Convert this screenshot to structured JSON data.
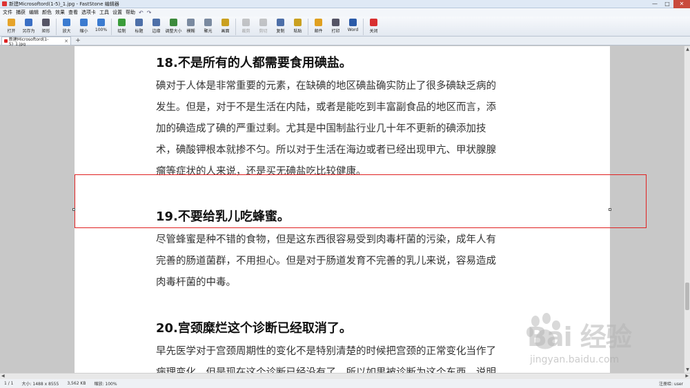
{
  "window": {
    "title": "新建Microsoftord(1-5)_1.jpg - FastStone 编辑器",
    "controls": [
      "—",
      "□",
      "✕"
    ]
  },
  "menu": {
    "items": [
      "文件",
      "捕获",
      "编辑",
      "颜色",
      "效果",
      "查看",
      "选项卡",
      "工具",
      "设置",
      "帮助"
    ]
  },
  "toolbar": {
    "tools": [
      {
        "label": "打开",
        "icon": "open-folder-icon",
        "color": "#e6a42b"
      },
      {
        "label": "另存为",
        "icon": "save-icon",
        "color": "#3a6fc4"
      },
      {
        "label": "矩形",
        "icon": "rect-select-icon",
        "color": "#556"
      },
      {
        "label": "放大",
        "icon": "zoom-in-icon",
        "color": "#3b7bd0"
      },
      {
        "label": "缩小",
        "icon": "zoom-out-icon",
        "color": "#3b7bd0"
      },
      {
        "label": "100%",
        "icon": "zoom-100-icon",
        "color": "#3b7bd0"
      },
      {
        "label": "绘制",
        "icon": "draw-icon",
        "color": "#3a9c3a"
      },
      {
        "label": "标题",
        "icon": "caption-icon",
        "color": "#4d6fa8"
      },
      {
        "label": "边缘",
        "icon": "edge-icon",
        "color": "#4d6fa8"
      },
      {
        "label": "调整大小",
        "icon": "resize-icon",
        "color": "#3c8a3c"
      },
      {
        "label": "模糊",
        "icon": "blur-icon",
        "color": "#7a8aa0"
      },
      {
        "label": "聚光",
        "icon": "spotlight-icon",
        "color": "#7a8aa0"
      },
      {
        "label": "画面",
        "icon": "canvas-icon",
        "color": "#caa020"
      },
      {
        "label": "裁剪",
        "icon": "crop-icon",
        "color": "#888",
        "disabled": true
      },
      {
        "label": "剪切",
        "icon": "cut-icon",
        "color": "#888",
        "disabled": true
      },
      {
        "label": "复制",
        "icon": "copy-icon",
        "color": "#4d6fa8"
      },
      {
        "label": "粘贴",
        "icon": "paste-icon",
        "color": "#caa020"
      },
      {
        "label": "邮件",
        "icon": "mail-icon",
        "color": "#e0a020"
      },
      {
        "label": "打印",
        "icon": "print-icon",
        "color": "#556"
      },
      {
        "label": "Word",
        "icon": "word-icon",
        "color": "#2b5ba8"
      },
      {
        "label": "关闭",
        "icon": "close-power-icon",
        "color": "#d83030"
      }
    ]
  },
  "tab": {
    "label": "新建Microsoftord(1-5)_1.jpg",
    "close": "✕",
    "new_tab": "+"
  },
  "article": {
    "sections": [
      {
        "heading": "18.不是所有的人都需要食用碘盐。",
        "lines": [
          "碘对于人体是非常重要的元素，在缺碘的地区碘盐确实防止了很多碘缺乏病的",
          "发生。但是，对于不是生活在内陆，或者是能吃到丰富副食品的地区而言，添",
          "加的碘造成了碘的严重过剩。尤其是中国制盐行业几十年不更新的碘添加技",
          "术，碘酸钾根本就掺不匀。所以对于生活在海边或者已经出现甲亢、甲状腺腺",
          "瘤等症状的人来说，还是买无碘盐吃比较健康。"
        ]
      },
      {
        "heading": "19.不要给乳儿吃蜂蜜。",
        "lines": [
          "尽管蜂蜜是种不错的食物，但是这东西很容易受到肉毒杆菌的污染，成年人有",
          "完善的肠道菌群，不用担心。但是对于肠道发育不完善的乳儿来说，容易造成",
          "肉毒杆菌的中毒。"
        ]
      },
      {
        "heading": "20.宫颈糜烂这个诊断已经取消了。",
        "lines": [
          "早先医学对于宫颈周期性的变化不是特别清楚的时候把宫颈的正常变化当作了",
          "病理变化。但是现在这个诊断已经没有了，所以如果被诊断为这个东西，说明"
        ]
      }
    ]
  },
  "watermark": {
    "text": "Bai 经验",
    "url": "jingyan.baidu.com"
  },
  "status": {
    "page": "1 / 1",
    "size": "大小: 1488 x 8555",
    "filesize": "3,562 KB",
    "zoom": "缩放: 100%",
    "user": "注册给: user"
  }
}
